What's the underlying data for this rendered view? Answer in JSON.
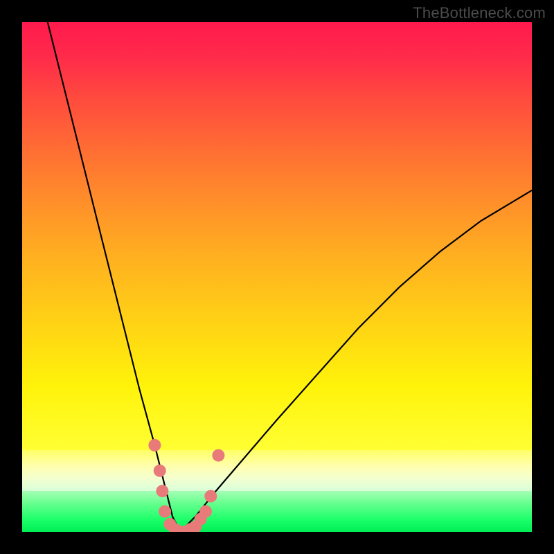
{
  "watermark": "TheBottleneck.com",
  "chart_data": {
    "type": "line",
    "title": "",
    "xlabel": "",
    "ylabel": "",
    "xlim": [
      0,
      100
    ],
    "ylim": [
      0,
      100
    ],
    "grid": false,
    "notes": "Unlabeled bottleneck curve plotted over a vertical red→yellow→green gradient. No axes, ticks, or numeric labels are visible. The vertex of the curve sits at roughly x≈31 on the 0–100 horizontal span and near y≈0. Pink dot markers cluster around the vertex.",
    "series": [
      {
        "name": "curve-left",
        "stroke": "#000000",
        "x": [
          5,
          8,
          11,
          14,
          17,
          20,
          23,
          26,
          28,
          29.5,
          31
        ],
        "y": [
          100,
          88,
          76,
          64,
          52,
          40,
          28,
          17,
          9,
          3,
          0
        ]
      },
      {
        "name": "curve-right",
        "stroke": "#000000",
        "x": [
          31,
          34,
          38,
          44,
          50,
          58,
          66,
          74,
          82,
          90,
          100
        ],
        "y": [
          0,
          3,
          8,
          15,
          22,
          31,
          40,
          48,
          55,
          61,
          67
        ]
      }
    ],
    "markers": {
      "name": "vertex-dots",
      "color": "#e97a7a",
      "points": [
        {
          "x": 26.0,
          "y": 17
        },
        {
          "x": 27.0,
          "y": 12
        },
        {
          "x": 27.5,
          "y": 8
        },
        {
          "x": 28.0,
          "y": 4
        },
        {
          "x": 29.0,
          "y": 1.5
        },
        {
          "x": 30.0,
          "y": 0.5
        },
        {
          "x": 31.0,
          "y": 0.0
        },
        {
          "x": 32.0,
          "y": 0.0
        },
        {
          "x": 33.0,
          "y": 0.5
        },
        {
          "x": 34.0,
          "y": 1.0
        },
        {
          "x": 35.0,
          "y": 2.5
        },
        {
          "x": 36.0,
          "y": 4
        },
        {
          "x": 37.0,
          "y": 7
        },
        {
          "x": 38.5,
          "y": 15
        }
      ]
    }
  }
}
